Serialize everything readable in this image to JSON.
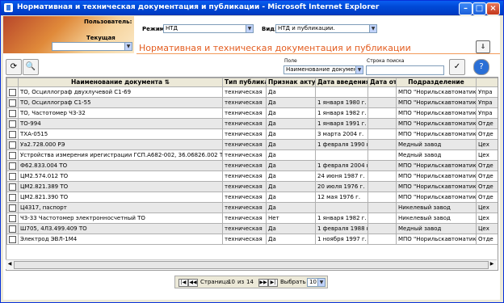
{
  "window": {
    "title": "Нормативная и техническая документация и публикации - Microsoft Internet Explorer"
  },
  "header": {
    "user_label": "Пользователь:",
    "role_label": "Текущая роль:",
    "mode_label": "Режим:",
    "mode_value": "НТД",
    "type_label": "Вид:",
    "type_value": "НТД и публикации.",
    "page_title": "Нормативная и техническая документация и публикации"
  },
  "toolbar": {
    "field_label": "Поле",
    "field_value": "Наименование докумен",
    "search_label": "Строка поиска",
    "search_value": ""
  },
  "table": {
    "columns": [
      "Наименование документа",
      "Тип публикации",
      "Признак актуальности",
      "Дата введения",
      "Дата отмены",
      "Подразделение",
      ""
    ],
    "rows": [
      [
        "ТО, Осциллограф двухлучевой С1-69",
        "техническая",
        "Да",
        "",
        "",
        "МПО \"Норильскавтоматика\"",
        "Упра"
      ],
      [
        "ТО, Осциллограф С1-55",
        "техническая",
        "Да",
        "1 января 1980 г.",
        "",
        "МПО \"Норильскавтоматика\"",
        "Упра"
      ],
      [
        "ТО, Частотомер Ч3-32",
        "техническая",
        "Да",
        "1 января 1982 г.",
        "",
        "МПО \"Норильскавтоматика\"",
        "Упра"
      ],
      [
        "ТО-994",
        "техническая",
        "Да",
        "1 января 1991 г.",
        "",
        "МПО \"Норильскавтоматика\"",
        "Отде"
      ],
      [
        "ТХА-0515",
        "техническая",
        "Да",
        "3 марта 2004 г.",
        "",
        "МПО \"Норильскавтоматика\"",
        "Отде"
      ],
      [
        "Уа2.728.000 РЭ",
        "техническая",
        "Да",
        "1 февраля 1990 г.",
        "",
        "Медный завод",
        "Цех"
      ],
      [
        "Устройства измерения ирегистрации ГСП.А682-002, 36.06826.002 ТО",
        "техническая",
        "Да",
        "",
        "",
        "Медный завод",
        "Цех"
      ],
      [
        "Ф62.833.004 ТО",
        "техническая",
        "Да",
        "1 февраля 2004 г.",
        "",
        "МПО \"Норильскавтоматика\"",
        "Отде"
      ],
      [
        "ЦМ2.574.012 ТО",
        "техническая",
        "Да",
        "24 июня 1987 г.",
        "",
        "МПО \"Норильскавтоматика\"",
        "Отде"
      ],
      [
        "ЦМ2.821.389 ТО",
        "техническая",
        "Да",
        "20 июля 1976 г.",
        "",
        "МПО \"Норильскавтоматика\"",
        "Отде"
      ],
      [
        "ЦМ2.821.390 ТО",
        "техническая",
        "Да",
        "12 мая 1976 г.",
        "",
        "МПО \"Норильскавтоматика\"",
        "Отде"
      ],
      [
        "Ц4317, паспорт",
        "техническая",
        "Да",
        "",
        "",
        "Никелевый завод",
        "Цех"
      ],
      [
        "Ч3-33 Частотомер электронносчетный ТО",
        "техническая",
        "Нет",
        "1 января 1982 г.",
        "",
        "Никелевый завод",
        "Цех"
      ],
      [
        "Ш705, 4Л3.499.409 ТО",
        "техническая",
        "Да",
        "1 февраля 1988 г.",
        "",
        "Медный завод",
        "Цех"
      ],
      [
        "Электрод ЭВЛ-1М4",
        "техническая",
        "Да",
        "1 ноября 1997 г.",
        "",
        "МПО \"Норильскавтоматика\"",
        "Отде"
      ]
    ]
  },
  "pager": {
    "page_word": "Страница",
    "current": "10",
    "of_word": "из",
    "total": "14",
    "select_label": "Выбрать",
    "select_value": "10"
  }
}
